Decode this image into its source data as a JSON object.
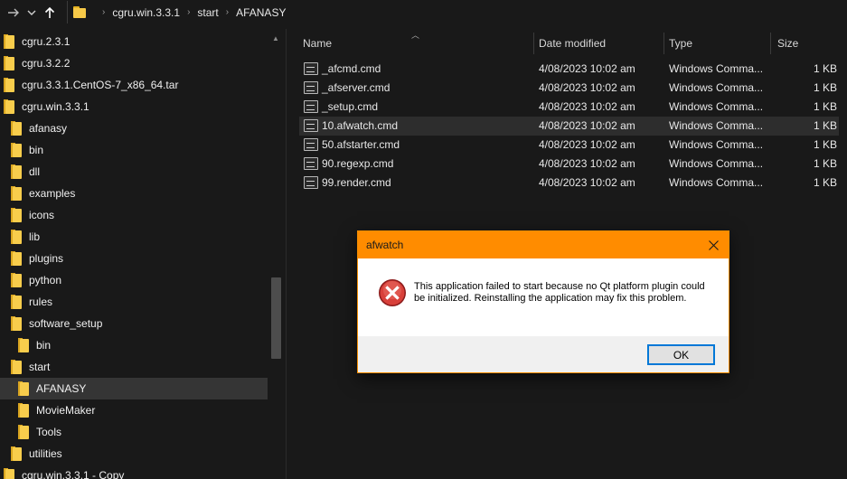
{
  "addressbar": {
    "path": [
      "cgru.win.3.3.1",
      "start",
      "AFANASY"
    ]
  },
  "tree": {
    "items": [
      {
        "label": "cgru.2.3.1",
        "indent": 0
      },
      {
        "label": "cgru.3.2.2",
        "indent": 0
      },
      {
        "label": "cgru.3.3.1.CentOS-7_x86_64.tar",
        "indent": 0
      },
      {
        "label": "cgru.win.3.3.1",
        "indent": 0
      },
      {
        "label": "afanasy",
        "indent": 1
      },
      {
        "label": "bin",
        "indent": 1
      },
      {
        "label": "dll",
        "indent": 1
      },
      {
        "label": "examples",
        "indent": 1
      },
      {
        "label": "icons",
        "indent": 1
      },
      {
        "label": "lib",
        "indent": 1
      },
      {
        "label": "plugins",
        "indent": 1
      },
      {
        "label": "python",
        "indent": 1
      },
      {
        "label": "rules",
        "indent": 1
      },
      {
        "label": "software_setup",
        "indent": 1
      },
      {
        "label": "bin",
        "indent": 2
      },
      {
        "label": "start",
        "indent": 1
      },
      {
        "label": "AFANASY",
        "indent": 2,
        "selected": true
      },
      {
        "label": "MovieMaker",
        "indent": 2
      },
      {
        "label": "Tools",
        "indent": 2
      },
      {
        "label": "utilities",
        "indent": 1
      },
      {
        "label": "cgru.win.3.3.1 - Copy",
        "indent": 0
      }
    ]
  },
  "columns": {
    "name": "Name",
    "date": "Date modified",
    "type": "Type",
    "size": "Size"
  },
  "files": [
    {
      "name": "_afcmd.cmd",
      "date": "4/08/2023 10:02 am",
      "type": "Windows Comma...",
      "size": "1 KB"
    },
    {
      "name": "_afserver.cmd",
      "date": "4/08/2023 10:02 am",
      "type": "Windows Comma...",
      "size": "1 KB"
    },
    {
      "name": "_setup.cmd",
      "date": "4/08/2023 10:02 am",
      "type": "Windows Comma...",
      "size": "1 KB"
    },
    {
      "name": "10.afwatch.cmd",
      "date": "4/08/2023 10:02 am",
      "type": "Windows Comma...",
      "size": "1 KB",
      "hover": true
    },
    {
      "name": "50.afstarter.cmd",
      "date": "4/08/2023 10:02 am",
      "type": "Windows Comma...",
      "size": "1 KB"
    },
    {
      "name": "90.regexp.cmd",
      "date": "4/08/2023 10:02 am",
      "type": "Windows Comma...",
      "size": "1 KB"
    },
    {
      "name": "99.render.cmd",
      "date": "4/08/2023 10:02 am",
      "type": "Windows Comma...",
      "size": "1 KB"
    }
  ],
  "dialog": {
    "title": "afwatch",
    "message": "This application failed to start because no Qt platform plugin could be initialized. Reinstalling the application may fix this problem.",
    "ok_label": "OK"
  },
  "icons": {
    "back": "back-arrow-icon",
    "forward": "forward-arrow-icon",
    "up": "up-arrow-icon",
    "folder": "folder-icon",
    "cmd": "cmd-file-icon",
    "error": "error-icon",
    "close": "close-icon"
  },
  "colors": {
    "dialog_titlebar": "#ff8c00",
    "selection": "#353535",
    "ok_focus": "#0078d7",
    "error_red": "#d32f2f"
  }
}
